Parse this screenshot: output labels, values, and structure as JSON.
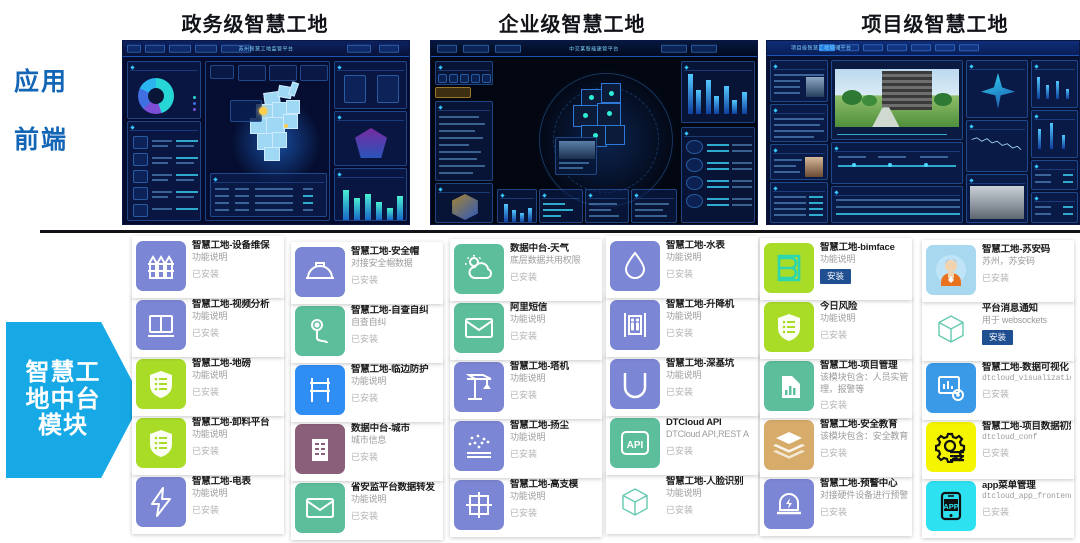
{
  "sections": [
    {
      "id": "gov",
      "title": "政务级智慧工地"
    },
    {
      "id": "ent",
      "title": "企业级智慧工地"
    },
    {
      "id": "project",
      "title": "项目级智慧工地"
    }
  ],
  "stage_labels": [
    {
      "text": "应用"
    },
    {
      "text": "前端"
    }
  ],
  "arrow": {
    "text": "智慧工地中台模块"
  },
  "status_installed": "已安装",
  "install_button": "安装",
  "colors": {
    "arrow_blue": "#17a9e6",
    "title_black": "#111319",
    "stage_blue": "#1366b5",
    "install_btn": "#1f4e91",
    "icon_periwinkle": "#7b86d4",
    "icon_green": "#5cbe9a",
    "icon_lime": "#a8dc27",
    "icon_blue": "#2f8ef4",
    "icon_mauve": "#8a5f7a",
    "icon_tan": "#d7ab6a",
    "icon_yellow": "#f5f500",
    "icon_cyan": "#2ee1f0",
    "icon_azure": "#3a9ae8",
    "icon_avatar": "#a8d8f0"
  },
  "columns": [
    {
      "index": 0,
      "cards": [
        {
          "title": "智慧工地-设备维保",
          "sub": "功能说明",
          "status": "已安装",
          "icon": "fence-icon",
          "icon_color": "#7b86d4",
          "state": "installed"
        },
        {
          "title": "智慧工地-视频分析",
          "sub": "功能说明",
          "status": "已安装",
          "icon": "video-icon",
          "icon_color": "#7b86d4",
          "state": "installed"
        },
        {
          "title": "智慧工地-地磅",
          "sub": "功能说明",
          "status": "已安装",
          "icon": "shield-list-icon",
          "icon_color": "#a8dc27",
          "state": "installed"
        },
        {
          "title": "智慧工地-卸料平台",
          "sub": "功能说明",
          "status": "已安装",
          "icon": "shield-list-icon",
          "icon_color": "#a8dc27",
          "state": "installed"
        },
        {
          "title": "智慧工地-电表",
          "sub": "功能说明",
          "status": "已安装",
          "icon": "bolt-icon",
          "icon_color": "#7b86d4",
          "state": "installed"
        }
      ]
    },
    {
      "index": 1,
      "cards": [
        {
          "title": "智慧工地-安全帽",
          "sub": "对接安全帽数据",
          "status": "已安装",
          "icon": "helmet-icon",
          "icon_color": "#7b86d4",
          "state": "installed"
        },
        {
          "title": "智慧工地-自查自纠",
          "sub": "自查自纠",
          "status": "已安装",
          "icon": "pin-path-icon",
          "icon_color": "#5cbe9a",
          "state": "installed"
        },
        {
          "title": "智慧工地-临边防护",
          "sub": "功能说明",
          "status": "已安装",
          "icon": "railing-icon",
          "icon_color": "#2f8ef4",
          "state": "installed"
        },
        {
          "title": "数据中台-城市",
          "sub": "城市信息",
          "status": "已安装",
          "icon": "building-icon",
          "icon_color": "#8a5f7a",
          "state": "installed"
        },
        {
          "title": "省安监平台数据转发",
          "sub": "功能说明",
          "status": "已安装",
          "icon": "mail-icon",
          "icon_color": "#5cbe9a",
          "state": "installed"
        }
      ]
    },
    {
      "index": 2,
      "cards": [
        {
          "title": "数据中台-天气",
          "sub": "底层数据共用权限",
          "status": "已安装",
          "icon": "weather-icon",
          "icon_color": "#5cbe9a",
          "state": "installed"
        },
        {
          "title": "阿里短信",
          "sub": "功能说明",
          "status": "已安装",
          "icon": "mail-icon",
          "icon_color": "#5cbe9a",
          "state": "installed"
        },
        {
          "title": "智慧工地-塔机",
          "sub": "功能说明",
          "status": "已安装",
          "icon": "crane-icon",
          "icon_color": "#7b86d4",
          "state": "installed"
        },
        {
          "title": "智慧工地-扬尘",
          "sub": "功能说明",
          "status": "已安装",
          "icon": "dust-icon",
          "icon_color": "#7b86d4",
          "state": "installed"
        },
        {
          "title": "智慧工地-高支模",
          "sub": "功能说明",
          "status": "已安装",
          "icon": "scaffold-icon",
          "icon_color": "#7b86d4",
          "state": "installed"
        }
      ]
    },
    {
      "index": 3,
      "cards": [
        {
          "title": "智慧工地-水表",
          "sub": "功能说明",
          "status": "已安装",
          "icon": "water-drop-icon",
          "icon_color": "#7b86d4",
          "state": "installed"
        },
        {
          "title": "智慧工地-升降机",
          "sub": "功能说明",
          "status": "已安装",
          "icon": "elevator-icon",
          "icon_color": "#7b86d4",
          "state": "installed"
        },
        {
          "title": "智慧工地-深基坑",
          "sub": "功能说明",
          "status": "已安装",
          "icon": "pit-icon",
          "icon_color": "#7b86d4",
          "state": "installed"
        },
        {
          "title": "DTCloud API",
          "sub": "DTCloud API,REST A",
          "status": "已安装",
          "icon": "api-icon",
          "icon_color": "#5cbe9a",
          "state": "installed"
        },
        {
          "title": "智慧工地-人脸识别",
          "sub": "功能说明",
          "status": "已安装",
          "icon": "cube-icon",
          "icon_color": "#ffffff",
          "state": "installed"
        }
      ]
    },
    {
      "index": 4,
      "cards": [
        {
          "title": "智慧工地-bimface",
          "sub": "功能说明",
          "status": "安装",
          "icon": "bimface-icon",
          "icon_color": "#a8dc27",
          "state": "not-installed"
        },
        {
          "title": "今日风险",
          "sub": "功能说明",
          "status": "已安装",
          "icon": "shield-list-icon",
          "icon_color": "#a8dc27",
          "state": "installed"
        },
        {
          "title": "智慧工地-项目管理",
          "sub": "该模块包含：人员实管理，报警等",
          "status": "已安装",
          "icon": "chart-building-icon",
          "icon_color": "#5cbe9a",
          "state": "installed"
        },
        {
          "title": "智慧工地-安全教育",
          "sub": "该模块包含：安全教育",
          "status": "已安装",
          "icon": "layers-icon",
          "icon_color": "#d7ab6a",
          "state": "installed"
        },
        {
          "title": "智慧工地-预警中心",
          "sub": "对接硬件设备进行预警",
          "status": "已安装",
          "icon": "alarm-icon",
          "icon_color": "#7b86d4",
          "state": "installed"
        }
      ]
    },
    {
      "index": 5,
      "cards": [
        {
          "title": "智慧工地-苏安码",
          "sub": "苏州，苏安码",
          "status": "已安装",
          "icon": "avatar-icon",
          "icon_color": "#a8d8f0",
          "state": "installed"
        },
        {
          "title": "平台消息通知",
          "sub": "用于 websockets",
          "status": "安装",
          "icon": "cube-icon",
          "icon_color": "#ffffff",
          "state": "not-installed"
        },
        {
          "title": "智慧工地-数据可视化",
          "sub": "dtcloud_visualization",
          "status": "已安装",
          "icon": "dataviz-icon",
          "icon_color": "#3a9ae8",
          "state": "installed",
          "mono": true
        },
        {
          "title": "智慧工地-项目数据初始化",
          "sub": "dtcloud_conf",
          "status": "已安装",
          "icon": "gear-list-icon",
          "icon_color": "#f5f500",
          "state": "installed",
          "mono": true
        },
        {
          "title": "app菜单管理",
          "sub": "dtcloud_app_frontend",
          "status": "已安装",
          "icon": "app-phone-icon",
          "icon_color": "#2ee1f0",
          "state": "installed",
          "mono": true
        }
      ]
    }
  ],
  "dashboards": [
    {
      "id": "gov",
      "caption": "苏州智慧工地监管平台"
    },
    {
      "id": "ent",
      "caption": "中交某智能建管平台"
    },
    {
      "id": "project",
      "caption": "项目级智慧工地管理平台"
    }
  ]
}
